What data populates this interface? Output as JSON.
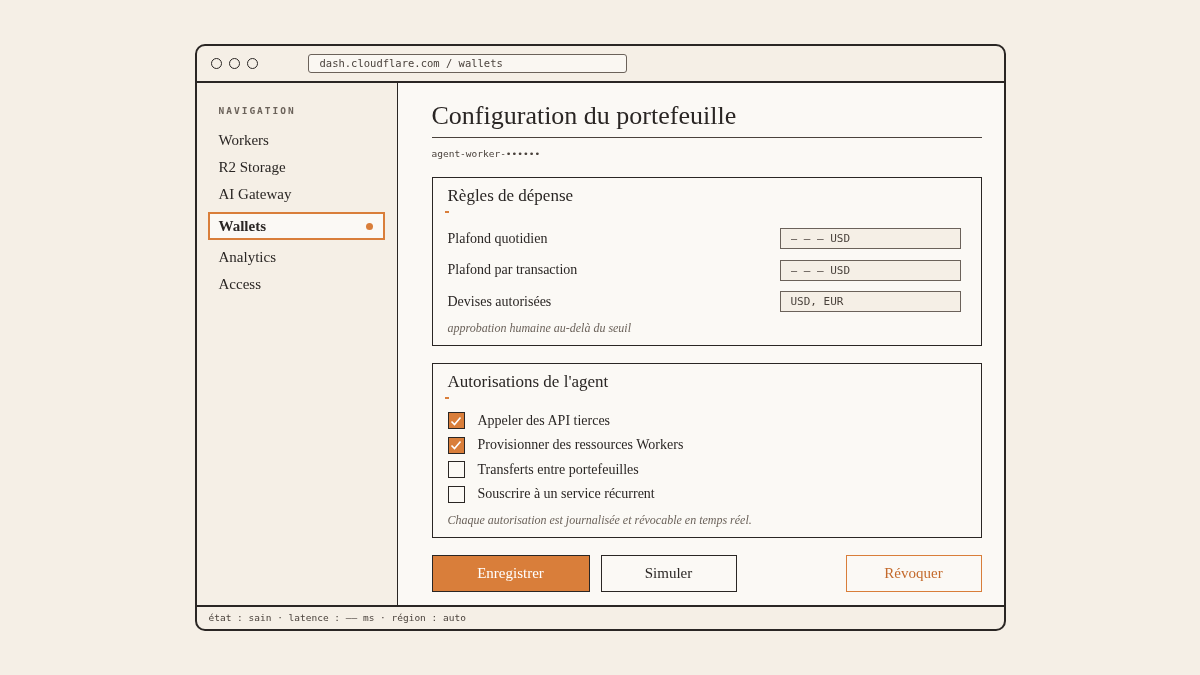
{
  "window": {
    "address": "dash.cloudflare.com / wallets"
  },
  "sidebar": {
    "heading": "NAVIGATION",
    "items": [
      {
        "label": "Workers",
        "selected": false
      },
      {
        "label": "R2 Storage",
        "selected": false
      },
      {
        "label": "AI Gateway",
        "selected": false
      },
      {
        "label": "Wallets",
        "selected": true
      },
      {
        "label": "Analytics",
        "selected": false
      },
      {
        "label": "Access",
        "selected": false
      }
    ]
  },
  "page": {
    "title": "Configuration du portefeuille",
    "subtitle": "agent-worker-••••••"
  },
  "spending_rules": {
    "title": "Règles de dépense",
    "fields": [
      {
        "label": "Plafond quotidien",
        "value": "— — — USD"
      },
      {
        "label": "Plafond par transaction",
        "value": "— — — USD"
      },
      {
        "label": "Devises autorisées",
        "value": "USD, EUR"
      }
    ],
    "note": "approbation humaine au-delà du seuil"
  },
  "permissions": {
    "title": "Autorisations de l'agent",
    "items": [
      {
        "label": "Appeler des API tierces",
        "checked": true
      },
      {
        "label": "Provisionner des ressources Workers",
        "checked": true
      },
      {
        "label": "Transferts entre portefeuilles",
        "checked": false
      },
      {
        "label": "Souscrire à un service récurrent",
        "checked": false
      }
    ],
    "note": "Chaque autorisation est journalisée et révocable en temps réel."
  },
  "buttons": [
    {
      "label": "Enregistrer",
      "kind": "primary"
    },
    {
      "label": "Simuler",
      "kind": "secondary"
    },
    {
      "label": "Révoquer",
      "kind": "danger"
    }
  ],
  "status_bar": "état : sain · latence : —— ms · région : auto"
}
